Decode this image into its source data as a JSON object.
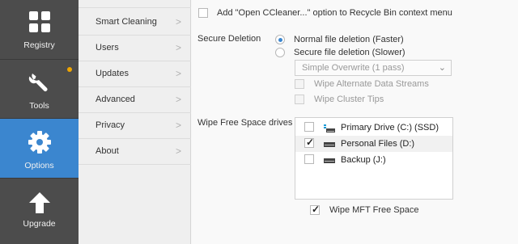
{
  "nav": {
    "registry": "Registry",
    "tools": "Tools",
    "options": "Options",
    "upgrade": "Upgrade"
  },
  "submenu": [
    "Smart Cleaning",
    "Users",
    "Updates",
    "Advanced",
    "Privacy",
    "About"
  ],
  "recycle_option": "Add \"Open CCleaner...\" option to Recycle Bin context menu",
  "secure_deletion": {
    "label": "Secure Deletion",
    "normal": "Normal file deletion (Faster)",
    "secure": "Secure file deletion (Slower)",
    "method": "Simple Overwrite (1 pass)",
    "wipe_ads": "Wipe Alternate Data Streams",
    "wipe_tips": "Wipe Cluster Tips"
  },
  "wipe_free": {
    "label": "Wipe Free Space drives",
    "drives": [
      {
        "name": "Primary Drive (C:) (SSD)",
        "checked": false
      },
      {
        "name": "Personal Files (D:)",
        "checked": true
      },
      {
        "name": "Backup  (J:)",
        "checked": false
      }
    ],
    "mft": "Wipe MFT Free Space",
    "mft_checked": true
  },
  "colors": {
    "accent": "#3b86cf",
    "sidebar": "#4c4c4c",
    "badge": "#f0a500"
  }
}
